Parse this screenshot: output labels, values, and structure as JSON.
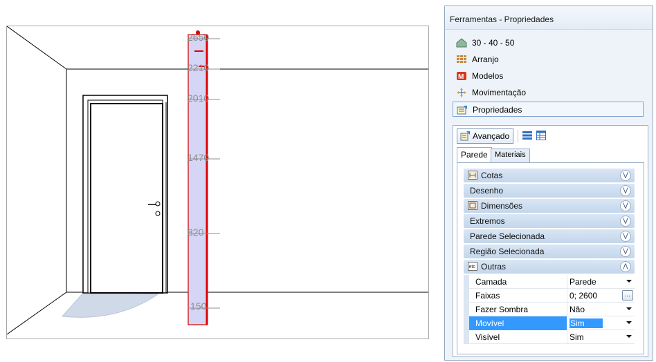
{
  "viewport": {
    "dimension_labels": [
      "2650",
      "2210",
      "2010",
      "1470",
      "820",
      "150"
    ]
  },
  "panel": {
    "title": "Ferramentas - Propriedades",
    "nav_items": [
      {
        "label": "30 - 40 - 50",
        "icon": "house-icon"
      },
      {
        "label": "Arranjo",
        "icon": "grid-arrange-icon"
      },
      {
        "label": "Modelos",
        "icon": "models-icon"
      },
      {
        "label": "Movimentação",
        "icon": "move-arrows-icon"
      },
      {
        "label": "Propriedades",
        "icon": "properties-icon"
      }
    ],
    "toolbar": {
      "advanced_label": "Avançado"
    },
    "tabs": [
      "Parede",
      "Materiais"
    ],
    "groups": [
      "Cotas",
      "Desenho",
      "Dimensões",
      "Extremos",
      "Parede Selecionada",
      "Região Selecionada",
      "Outras"
    ],
    "properties": [
      {
        "name": "Camada",
        "value": "Parede"
      },
      {
        "name": "Faixas",
        "value": "0; 2600"
      },
      {
        "name": "Fazer Sombra",
        "value": "Não"
      },
      {
        "name": "Movível",
        "value": "Sim"
      },
      {
        "name": "Visível",
        "value": "Sim"
      }
    ],
    "colors": {
      "accent": "#3399ff",
      "group_header": "#c3d6ec"
    }
  }
}
